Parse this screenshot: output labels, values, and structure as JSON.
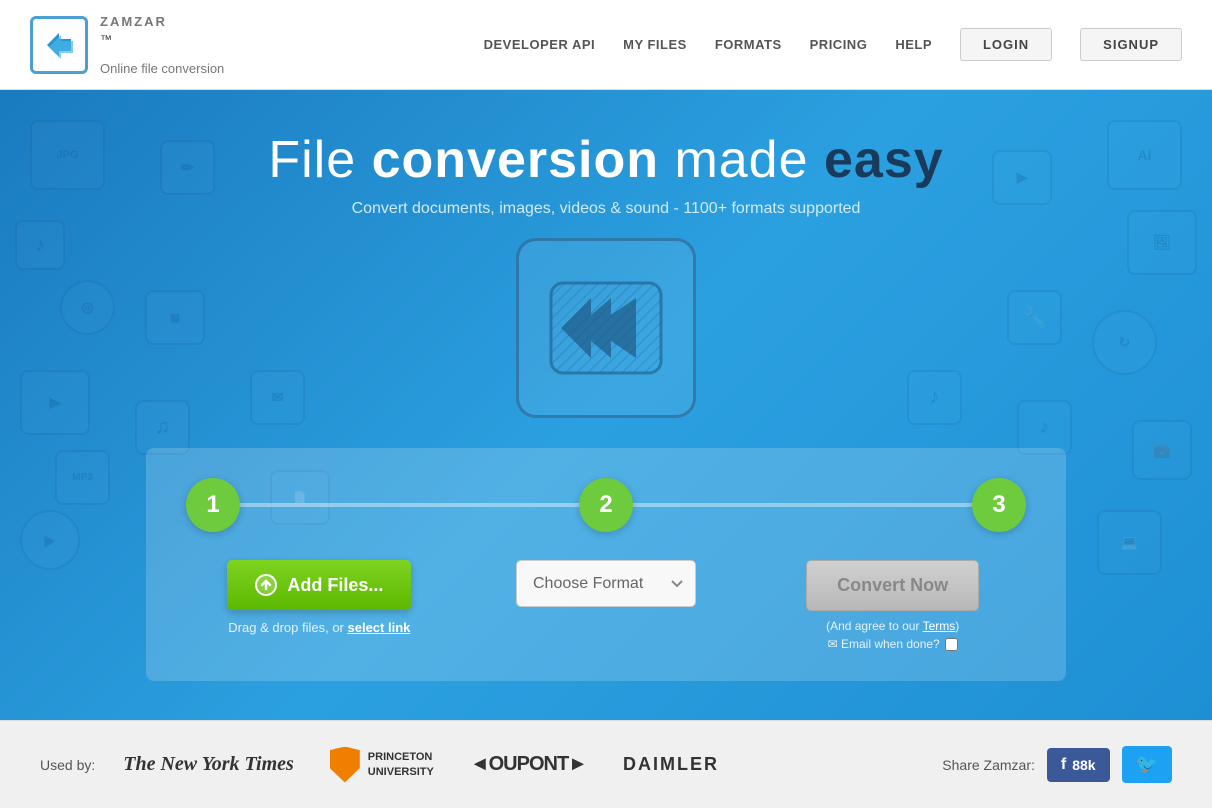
{
  "header": {
    "logo_tm": "™",
    "logo_name": "ZAMZAR",
    "logo_tagline": "Online file conversion",
    "nav": {
      "developer_api": "DEVELOPER API",
      "my_files": "MY FILES",
      "formats": "FORMATS",
      "pricing": "PRICING",
      "help": "HELP",
      "login": "LOGIN",
      "signup": "SIGNUP"
    }
  },
  "hero": {
    "title_part1": "File ",
    "title_bold": "conversion",
    "title_part2": " made ",
    "title_easy": "easy",
    "subtitle": "Convert documents, images, videos & sound - 1100+ formats supported"
  },
  "steps": {
    "step1_num": "1",
    "step2_num": "2",
    "step3_num": "3",
    "add_files_label": "Add Files...",
    "drag_drop_text": "Drag & drop files, or ",
    "select_link_text": "select link",
    "choose_format_label": "Choose Format",
    "choose_format_arrow": "▾",
    "convert_now_label": "Convert Now",
    "agree_text": "(And agree to our ",
    "terms_text": "Terms",
    "agree_end": ")",
    "email_label": "✉ Email when done?",
    "email_checkbox": ""
  },
  "footer": {
    "used_by_label": "Used by:",
    "brands": [
      {
        "name": "The New York Times",
        "style": "nyt"
      },
      {
        "name": "PRINCETON\nUNIVERSITY",
        "style": "princeton"
      },
      {
        "name": "◄OUPONT►",
        "style": "dupont"
      },
      {
        "name": "DAIMLER",
        "style": "daimler"
      }
    ],
    "share_label": "Share Zamzar:",
    "fb_label": "f",
    "fb_count": "88k",
    "twitter_label": "🐦"
  }
}
